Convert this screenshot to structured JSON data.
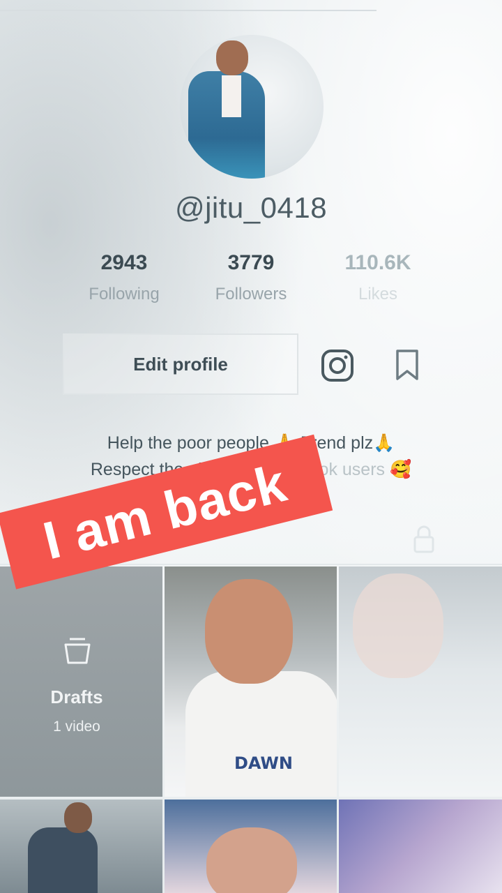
{
  "profile": {
    "username": "@jitu_0418",
    "stats": [
      {
        "value": "2943",
        "label": "Following"
      },
      {
        "value": "3779",
        "label": "Followers"
      },
      {
        "value": "110.6K",
        "label": "Likes"
      }
    ],
    "edit_label": "Edit profile",
    "bio_line1": "Help the poor people",
    "bio_line1_emoji1": "🙏",
    "bio_line1_mid": "Frend plz",
    "bio_line1_emoji2": "🙏",
    "bio_line2": "Respect the girl's..",
    "bio_line2_emoji1": "🥰",
    "bio_line2_mid": "Odia tiktok users",
    "bio_line2_emoji2": "🥰"
  },
  "overlay": {
    "sticker_text": "I am back",
    "sticker_color": "#f4554d"
  },
  "grid": {
    "drafts_title": "Drafts",
    "drafts_count": "1 video",
    "tee_text": "DAWN"
  },
  "icons": [
    "instagram-icon",
    "bookmark-icon",
    "lock-icon",
    "drafts-icon"
  ]
}
